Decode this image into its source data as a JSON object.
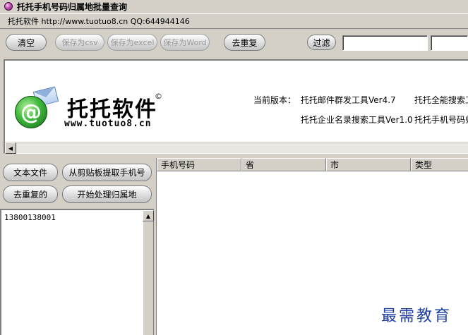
{
  "window": {
    "title": "托托手机号码归属地批量查询"
  },
  "infobar": {
    "text": "托托软件 http://www.tuotuo8.cn QQ:644944146"
  },
  "toolbar": {
    "clear": "清空",
    "save_csv": "保存为csv",
    "save_excel": "保存为excel",
    "save_word": "保存为Word",
    "dedupe": "去重复",
    "filter": "过滤",
    "filter_input_1": "",
    "filter_input_2": ""
  },
  "banner": {
    "brand": "托托软件",
    "copyright": "©",
    "url": "www.tuotuo8.cn",
    "version_label": "当前版本：",
    "items": [
      "托托邮件群发工具Ver4.7",
      "托托全能搜索工",
      "托托企业名录搜索工具Ver1.0",
      "托托手机号码归"
    ]
  },
  "left": {
    "text_file": "文本文件",
    "from_clipboard": "从剪贴板提取手机号",
    "dedupe": "去重复的",
    "start": "开始处理归属地",
    "numbers": "13800138001"
  },
  "grid": {
    "columns": [
      "手机号码",
      "省",
      "市",
      "类型"
    ]
  },
  "watermark": "最需教育",
  "icons": {
    "app": "app-icon",
    "logo": "at-mail-logo-icon",
    "scroll_left": "scroll-left-arrow-icon",
    "scroll_up": "scroll-up-arrow-icon"
  }
}
